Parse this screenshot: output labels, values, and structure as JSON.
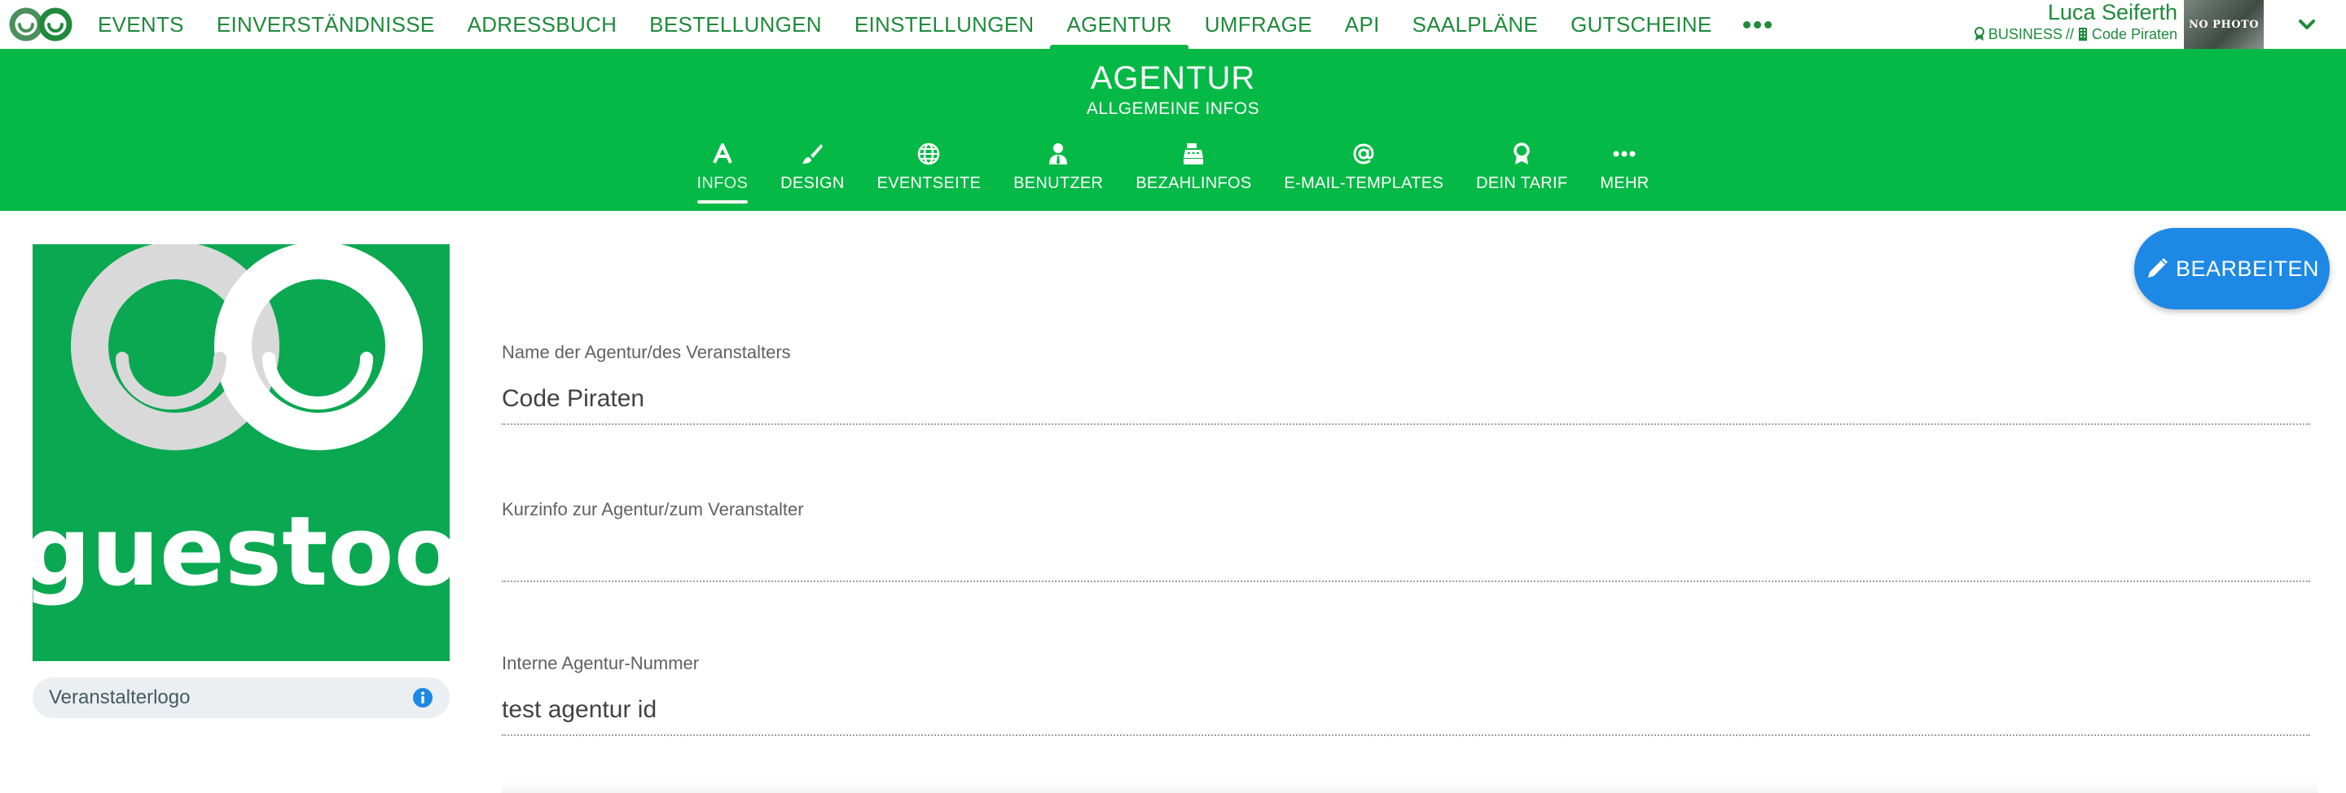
{
  "app": {
    "brand": "guestoo",
    "brand_color": "#04b945",
    "accent_color": "#1e88e5"
  },
  "nav": {
    "items": [
      {
        "label": "EVENTS",
        "active": false
      },
      {
        "label": "EINVERSTÄNDNISSE",
        "active": false
      },
      {
        "label": "ADRESSBUCH",
        "active": false
      },
      {
        "label": "BESTELLUNGEN",
        "active": false
      },
      {
        "label": "EINSTELLUNGEN",
        "active": false
      },
      {
        "label": "AGENTUR",
        "active": true
      },
      {
        "label": "UMFRAGE",
        "active": false
      },
      {
        "label": "API",
        "active": false
      },
      {
        "label": "SAALPLÄNE",
        "active": false
      },
      {
        "label": "GUTSCHEINE",
        "active": false
      }
    ],
    "more_icon": "more-dots-icon"
  },
  "user": {
    "name": "Luca Seiferth",
    "plan": "BUSINESS",
    "separator": "//",
    "company": "Code Piraten",
    "avatar_text": "NO PHOTO"
  },
  "header": {
    "title": "AGENTUR",
    "subtitle": "ALLGEMEINE INFOS"
  },
  "tabs": [
    {
      "label": "INFOS",
      "icon": "font-a-icon",
      "active": true
    },
    {
      "label": "DESIGN",
      "icon": "paintbrush-icon",
      "active": false
    },
    {
      "label": "EVENTSEITE",
      "icon": "globe-icon",
      "active": false
    },
    {
      "label": "BENUTZER",
      "icon": "user-tie-icon",
      "active": false
    },
    {
      "label": "BEZAHLINFOS",
      "icon": "cash-register-icon",
      "active": false
    },
    {
      "label": "E-MAIL-TEMPLATES",
      "icon": "at-icon",
      "active": false
    },
    {
      "label": "DEIN TARIF",
      "icon": "award-icon",
      "active": false
    },
    {
      "label": "MEHR",
      "icon": "more-dots-icon",
      "active": false
    }
  ],
  "logo_panel": {
    "logo_text": "guestoo",
    "caption": "Veranstalterlogo"
  },
  "edit_button": {
    "label": "BEARBEITEN"
  },
  "fields": [
    {
      "label": "Name der Agentur/des Veranstalters",
      "value": "Code Piraten"
    },
    {
      "label": "Kurzinfo zur Agentur/zum Veranstalter",
      "value": ""
    },
    {
      "label": "Interne Agentur-Nummer",
      "value": "test agentur id"
    }
  ]
}
